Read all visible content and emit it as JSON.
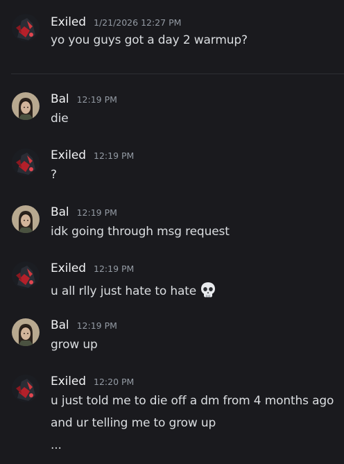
{
  "channel": {
    "messages": [
      {
        "author": "Exiled",
        "time": "1/21/2026 12:27 PM",
        "lines": [
          "yo you guys got a day 2 warmup?"
        ]
      },
      {
        "author": "Bal",
        "time": "12:19 PM",
        "lines": [
          "die"
        ]
      },
      {
        "author": "Exiled",
        "time": "12:19 PM",
        "lines": [
          "?"
        ]
      },
      {
        "author": "Bal",
        "time": "12:19 PM",
        "lines": [
          "idk going through msg request"
        ]
      },
      {
        "author": "Exiled",
        "time": "12:19 PM",
        "lines": [
          "u all rlly just hate to hate"
        ],
        "emoji": "skull-icon"
      },
      {
        "author": "Bal",
        "time": "12:19 PM",
        "lines": [
          "grow up"
        ]
      },
      {
        "author": "Exiled",
        "time": "12:20 PM",
        "lines": [
          "u just told me to die off a dm from 4 months ago",
          "and ur telling me to grow up",
          "..."
        ]
      }
    ]
  },
  "colors": {
    "background": "#1a1a1e",
    "author": "#f2f3f5",
    "timestamp": "#949ba4",
    "text": "#dbdee1"
  }
}
